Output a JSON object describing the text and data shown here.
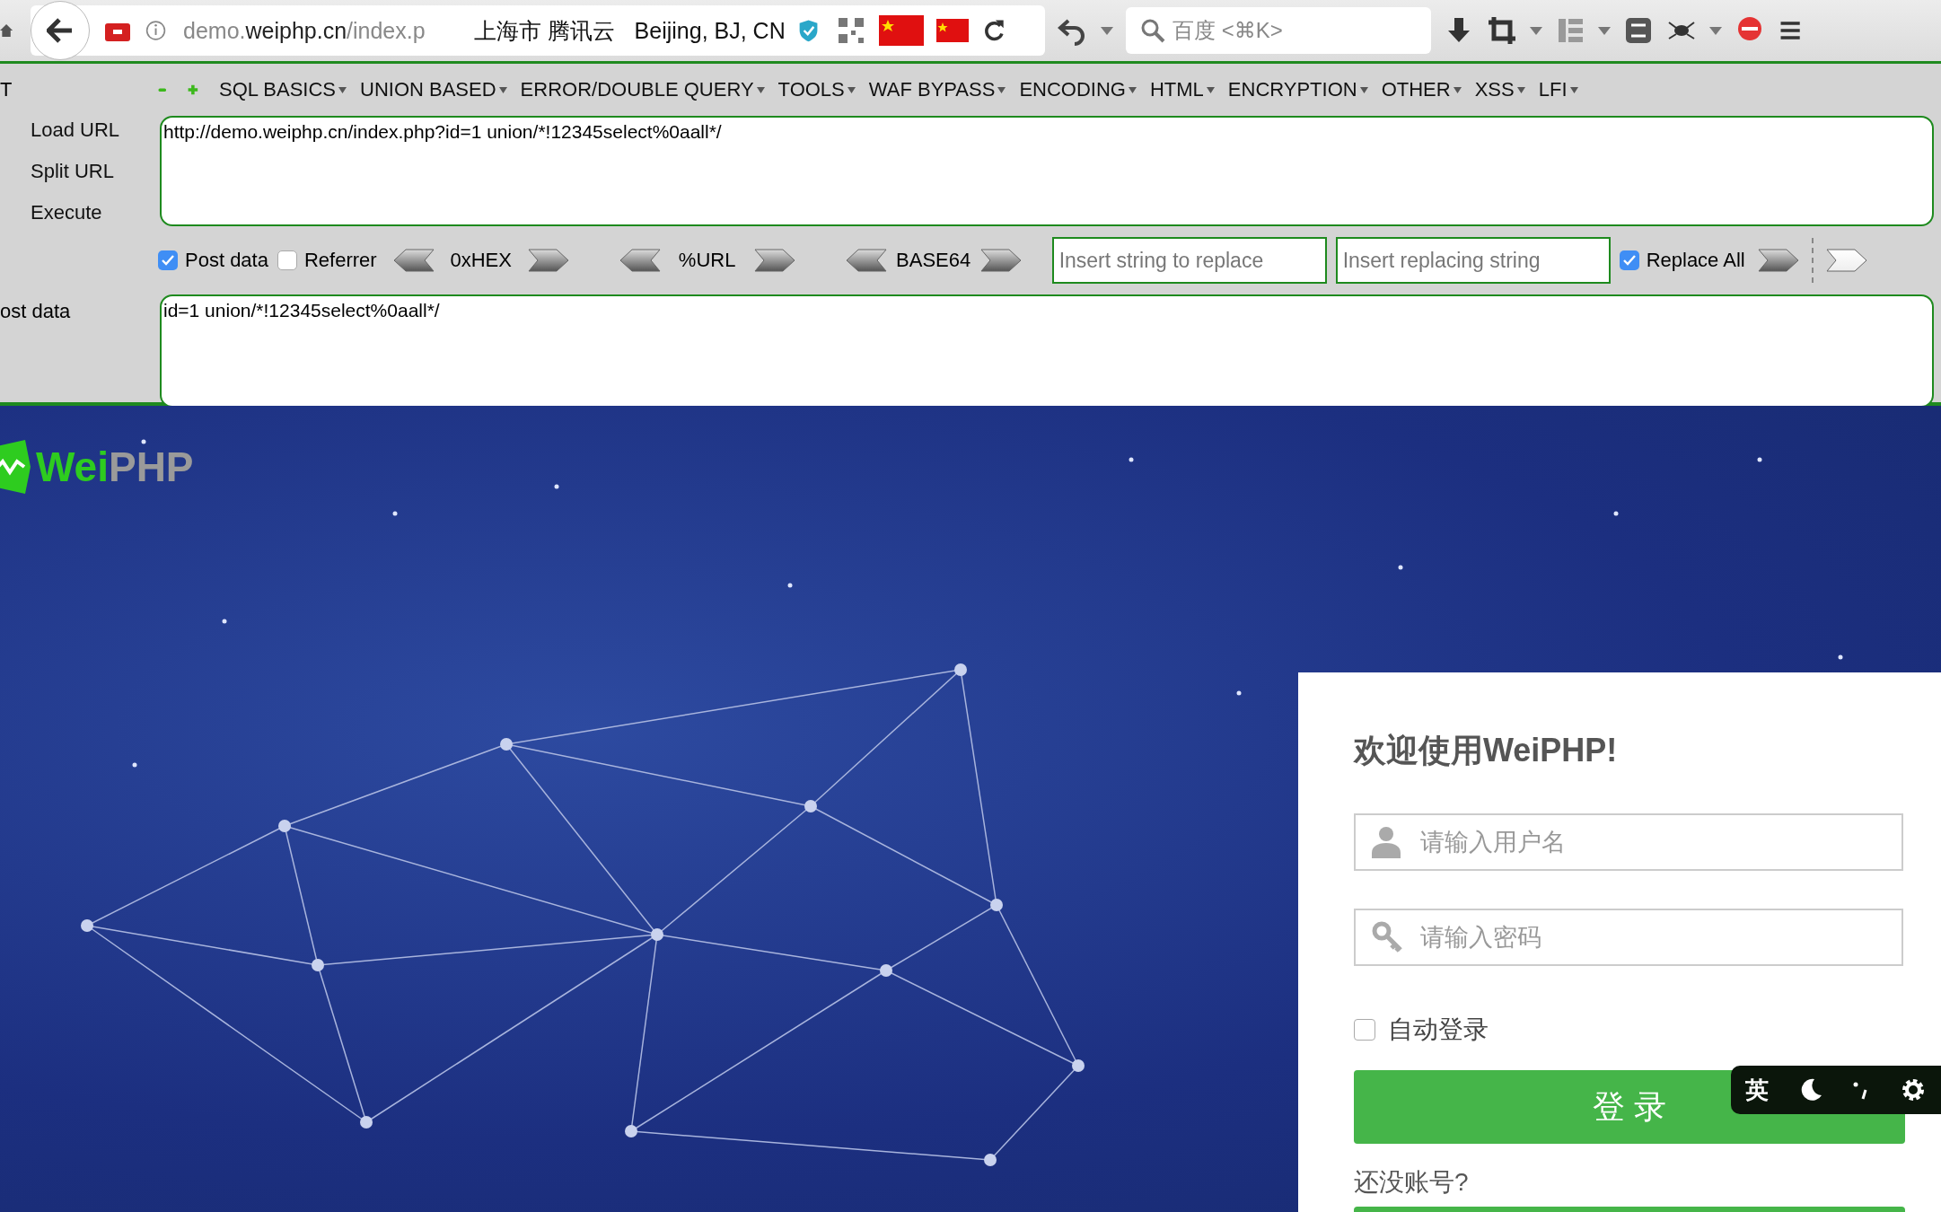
{
  "browser_toolbar": {
    "url": {
      "prefix": "demo.",
      "domain": "weiphp.cn",
      "path": "/index.p"
    },
    "location": "上海市 腾讯云",
    "geo": "Beijing, BJ, CN",
    "search": {
      "placeholder": "百度 <⌘K>"
    }
  },
  "hackbar": {
    "cut_label": "T",
    "menus": [
      "SQL BASICS",
      "UNION BASED",
      "ERROR/DOUBLE QUERY",
      "TOOLS",
      "WAF BYPASS",
      "ENCODING",
      "HTML",
      "ENCRYPTION",
      "OTHER",
      "XSS",
      "LFI"
    ],
    "actions": [
      "Load URL",
      "Split URL",
      "Execute"
    ],
    "url_value": "http://demo.weiphp.cn/index.php?id=1 union/*!12345select%0aall*/",
    "post_data": {
      "label": "Post data",
      "checked": true
    },
    "referrer": {
      "label": "Referrer",
      "checked": false
    },
    "encoders": [
      "0xHEX",
      "%URL",
      "BASE64"
    ],
    "replace_from": {
      "placeholder": "Insert string to replace"
    },
    "replace_to": {
      "placeholder": "Insert replacing string"
    },
    "replace_all": {
      "label": "Replace All",
      "checked": true
    },
    "post_label": "ost data",
    "post_value": "id=1 union/*!12345select%0aall*/"
  },
  "page": {
    "logo": {
      "lead": "Wei",
      "rest": "PHP"
    },
    "login": {
      "title": "欢迎使用WeiPHP!",
      "username": {
        "placeholder": "请输入用户名"
      },
      "password": {
        "placeholder": "请输入密码"
      },
      "remember": {
        "label": "自动登录",
        "checked": false
      },
      "submit": "登 录",
      "signup_prompt": "还没账号?"
    }
  },
  "ime_bar": {
    "mode": "英"
  }
}
